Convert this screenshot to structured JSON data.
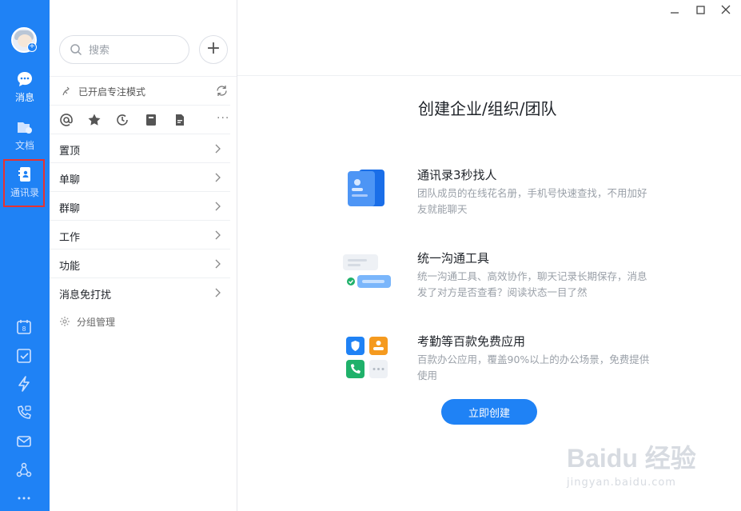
{
  "rail": {
    "nav": [
      {
        "key": "messages",
        "label": "消息"
      },
      {
        "key": "docs",
        "label": "文档"
      },
      {
        "key": "contacts",
        "label": "通讯录"
      }
    ],
    "tools": [
      "calendar-icon",
      "todo-check-icon",
      "lightning-icon",
      "video-call-icon",
      "mail-icon",
      "network-icon",
      "more-dots-icon"
    ]
  },
  "sidebar": {
    "search_placeholder": "搜索",
    "focus_mode": "已开启专注模式",
    "quick_filters": [
      "at-icon",
      "star-icon",
      "clock-icon",
      "archive-icon",
      "file-icon"
    ],
    "more": "···",
    "items": [
      {
        "label": "置顶"
      },
      {
        "label": "单聊"
      },
      {
        "label": "群聊"
      },
      {
        "label": "工作"
      },
      {
        "label": "功能"
      },
      {
        "label": "消息免打扰"
      }
    ],
    "group_manage": "分组管理"
  },
  "main": {
    "title": "创建企业/组织/团队",
    "features": [
      {
        "title": "通讯录3秒找人",
        "desc": "团队成员的在线花名册，手机号快速查找，不用加好友就能聊天"
      },
      {
        "title": "统一沟通工具",
        "desc": "统一沟通工具、高效协作，聊天记录长期保存，消息发了对方是否查看？阅读状态一目了然"
      },
      {
        "title": "考勤等百款免费应用",
        "desc": "百款办公应用，覆盖90%以上的办公场景，免费提供使用"
      }
    ],
    "create_button": "立即创建"
  },
  "watermark": {
    "main": "Baidu 经验",
    "sub": "jingyan.baidu.com"
  },
  "colors": {
    "brand": "#1f82f5",
    "highlight_box": "#e8322f"
  }
}
